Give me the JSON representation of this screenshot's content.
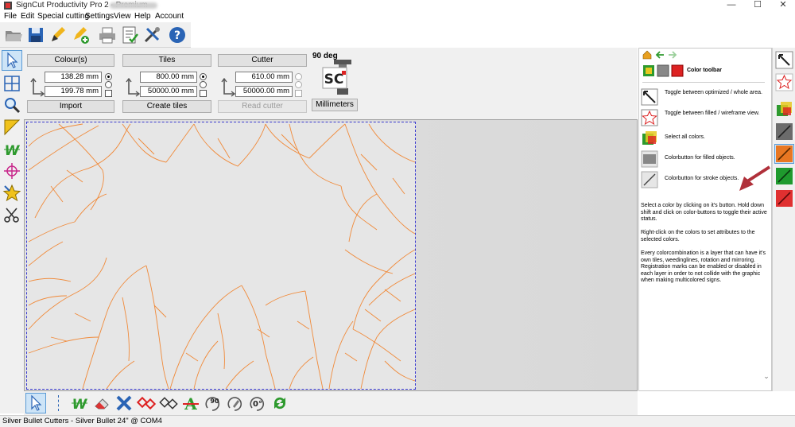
{
  "window": {
    "title": "SignCut Productivity Pro 2 - Premium",
    "minimize": "—",
    "maximize": "☐",
    "close": "✕"
  },
  "menu": [
    "File",
    "Edit",
    "Special cutting",
    "Settings",
    "View",
    "Help",
    "Account"
  ],
  "toolbar_icons": [
    "open-folder-icon",
    "save-icon",
    "pen-icon",
    "pen-add-icon",
    "printer-icon",
    "checklist-icon",
    "tools-icon",
    "help-icon"
  ],
  "left_tools": [
    "pointer-icon",
    "grid-icon",
    "zoom-icon",
    "ruler-icon",
    "weed-w-icon",
    "crosshair-icon",
    "star-icon",
    "scissors-icon"
  ],
  "groups": {
    "colours": {
      "title": "Colour(s)",
      "value1": "138.28 mm",
      "value2": "199.78 mm",
      "button": "Import"
    },
    "tiles": {
      "title": "Tiles",
      "value1": "800.00 mm",
      "value2": "50000.00 mm",
      "button": "Create tiles"
    },
    "cutter": {
      "title": "Cutter",
      "value1": "610.00 mm",
      "value2": "50000.00 mm",
      "button": "Read cutter"
    }
  },
  "rotation": {
    "label": "90 deg",
    "logo_text": "SC",
    "units_button": "Millimeters"
  },
  "right_panel": {
    "header": "Color toolbar",
    "items": [
      {
        "icon": "optimize-toggle-icon",
        "text": "Toggle between optimized / whole area."
      },
      {
        "icon": "fill-wireframe-toggle-icon",
        "text": "Toggle between filled / wireframe view."
      },
      {
        "icon": "select-all-colors-icon",
        "text": "Select all colors."
      },
      {
        "icon": "filled-colorbutton-icon",
        "text": "Colorbutton for filled objects."
      },
      {
        "icon": "stroke-colorbutton-icon",
        "text": "Colorbutton for stroke objects."
      }
    ],
    "para1": "Select a color by clicking on it's button. Hold down shift and click on color-buttons to toggle their active status.",
    "para2": "Right-click on the colors to set attributes to the selected colors.",
    "para3": "Every colorcombination is a layer that can have it's own tiles, weedinglines, rotation and mirroring. Registration marks can be enabled or disabled in each layer in order to not collide with the graphic when making multicolored signs."
  },
  "bottom_tools": [
    "pointer-icon",
    "separator",
    "weed-w-icon",
    "eraser-icon",
    "delete-x-icon",
    "nodes-red-icon",
    "nodes-outline-icon",
    "text-a-icon",
    "rotate-90-icon",
    "rotate-pen-icon",
    "rotate-0-icon",
    "refresh-icon"
  ],
  "bottom_labels": {
    "rot90": "90",
    "rot0": "0°"
  },
  "status": "Silver Bullet Cutters - Silver Bullet 24\" @ COM4",
  "colors": {
    "accent": "#e87722",
    "stroke": "#f08a3a",
    "page_border": "#3a3ad0",
    "arrow": "#b0303a"
  }
}
